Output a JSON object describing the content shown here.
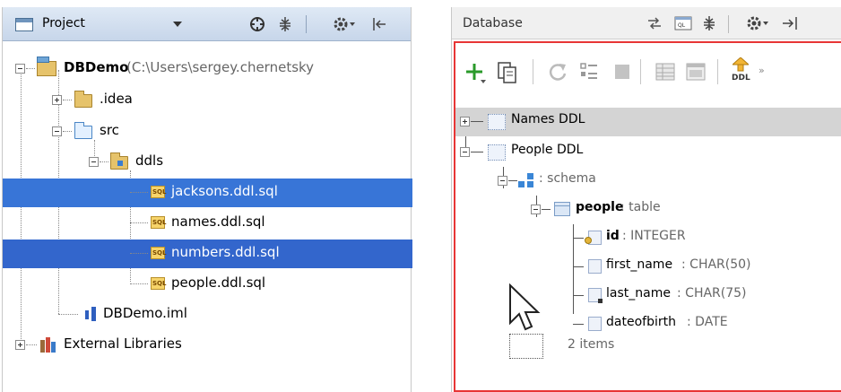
{
  "project": {
    "title": "Project",
    "tree": {
      "root": {
        "name": "DBDemo",
        "path": "(C:\\Users\\sergey.chernetsky"
      },
      "idea": ".idea",
      "src": "src",
      "ddls": "ddls",
      "files": [
        "jacksons.ddl.sql",
        "names.ddl.sql",
        "numbers.ddl.sql",
        "people.ddl.sql"
      ],
      "iml": "DBDemo.iml",
      "libs": "External Libraries"
    },
    "sql_icon_text": "SQL"
  },
  "database": {
    "title": "Database",
    "ddl_label": "DDL",
    "tree": {
      "names_ddl": "Names DDL",
      "people_ddl": "People DDL",
      "schema_label": ": schema",
      "table_name": "people",
      "table_suffix": ": table",
      "columns": [
        {
          "name": "id",
          "type": ": INTEGER"
        },
        {
          "name": "first_name",
          "type": ": CHAR(50)"
        },
        {
          "name": "last_name",
          "type": ": CHAR(75)"
        },
        {
          "name": "dateofbirth",
          "type": ": DATE"
        }
      ]
    },
    "drag_label": "2 items"
  },
  "colors": {
    "selection": "#3875d7",
    "red_border": "#e83535",
    "header_blue": "#c7d6ea"
  },
  "icons": [
    "settings-icon",
    "collapse-icon",
    "target-icon",
    "hide-icon",
    "add-icon",
    "copy-icon",
    "refresh-icon",
    "properties-icon",
    "stop-icon",
    "table-icon",
    "console-icon",
    "ddl-icon",
    "sync-icon",
    "open-query-icon"
  ]
}
